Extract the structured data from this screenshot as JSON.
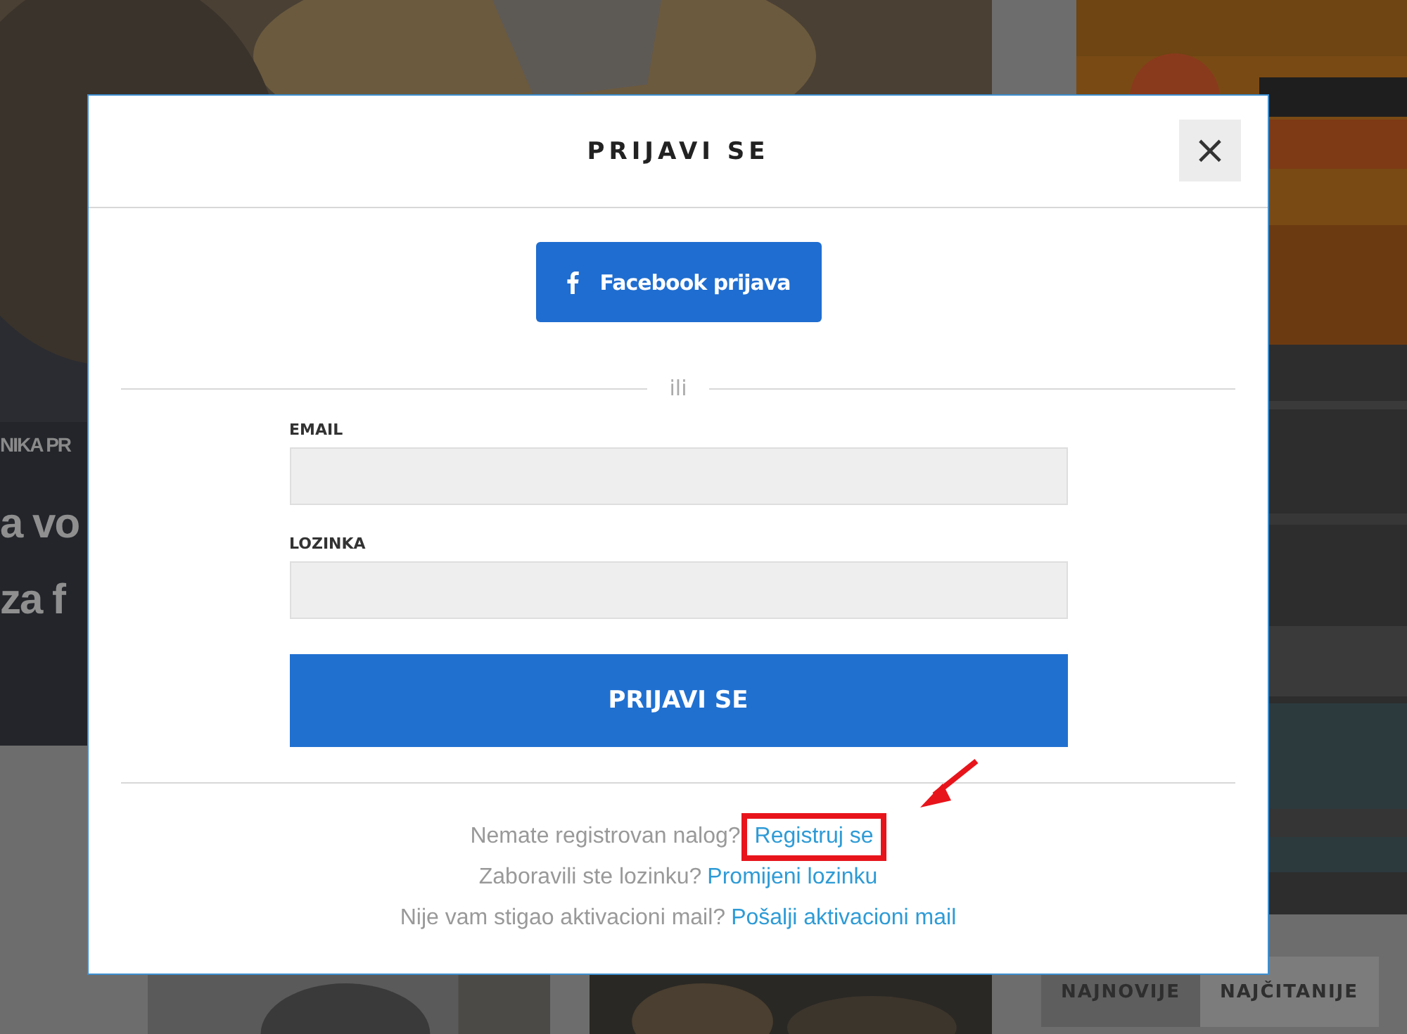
{
  "page": {
    "hero": {
      "category": "NIKA PR",
      "headline_lines": [
        "a vo",
        "za f"
      ]
    },
    "tabs": [
      {
        "label": "NAJNOVIJE",
        "selected": true
      },
      {
        "label": "NAJČITANIJE",
        "selected": false
      }
    ]
  },
  "modal": {
    "title": "PRIJAVI SE",
    "close": "×",
    "facebook_button": "Facebook prijava",
    "divider": "ili",
    "fields": [
      {
        "label": "EMAIL"
      },
      {
        "label": "LOZINKA"
      }
    ],
    "submit": "PRIJAVI SE",
    "footer_lines": [
      {
        "text": "Nemate registrovan nalog?",
        "link": "Registruj se",
        "highlighted": true
      },
      {
        "text": "Zaboravili ste lozinku?",
        "link": "Promijeni lozinku",
        "highlighted": false
      },
      {
        "text": "Nije vam stigao aktivacioni mail?",
        "link": "Pošalji aktivacioni mail",
        "highlighted": false
      }
    ]
  }
}
